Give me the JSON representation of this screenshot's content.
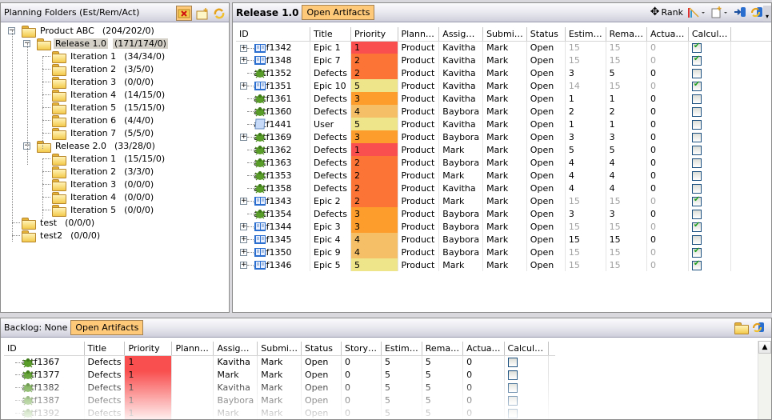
{
  "planning": {
    "title": "Planning Folders (Est/Rem/Act)",
    "toolbar": [
      {
        "name": "delete-folder-icon"
      },
      {
        "name": "new-folder-icon"
      },
      {
        "name": "refresh-icon"
      }
    ],
    "tree": [
      {
        "label": "Product ABC",
        "count": "(204/202/0)",
        "level": 0,
        "expand": "minus"
      },
      {
        "label": "Release 1.0",
        "count": "(171/174/0)",
        "level": 1,
        "expand": "minus",
        "selected": true
      },
      {
        "label": "Iteration 1",
        "count": "(34/34/0)",
        "level": 2
      },
      {
        "label": "Iteration 2",
        "count": "(3/5/0)",
        "level": 2
      },
      {
        "label": "Iteration 3",
        "count": "(0/0/0)",
        "level": 2
      },
      {
        "label": "Iteration 4",
        "count": "(14/15/0)",
        "level": 2
      },
      {
        "label": "Iteration 5",
        "count": "(15/15/0)",
        "level": 2
      },
      {
        "label": "Iteration 6",
        "count": "(4/4/0)",
        "level": 2
      },
      {
        "label": "Iteration 7",
        "count": "(5/5/0)",
        "level": 2
      },
      {
        "label": "Release 2.0",
        "count": "(33/28/0)",
        "level": 1,
        "expand": "minus"
      },
      {
        "label": "Iteration 1",
        "count": "(15/15/0)",
        "level": 2
      },
      {
        "label": "Iteration 2",
        "count": "(3/3/0)",
        "level": 2
      },
      {
        "label": "Iteration 3",
        "count": "(0/0/0)",
        "level": 2
      },
      {
        "label": "Iteration 4",
        "count": "(0/0/0)",
        "level": 2
      },
      {
        "label": "Iteration 5",
        "count": "(0/0/0)",
        "level": 2
      },
      {
        "label": "test",
        "count": "(0/0/0)",
        "level": 0
      },
      {
        "label": "test2",
        "count": "(0/0/0)",
        "level": 0
      }
    ]
  },
  "release": {
    "title": "Release 1.0",
    "filter_button": "Open Artifacts",
    "rank_label": "Rank",
    "columns": [
      "ID",
      "Title",
      "Priority",
      "Plann…",
      "Assig…",
      "Submi…",
      "Status",
      "Estim…",
      "Rema…",
      "Actua…",
      "Calcul…"
    ],
    "rows": [
      {
        "id": "artf1342",
        "type": "epic",
        "expand": true,
        "title": "Epic 1",
        "priority": 1,
        "planning": "Product",
        "assigned": "Kavitha",
        "submitted": "Mark",
        "status": "Open",
        "est": "15",
        "rem": "15",
        "act": "0",
        "calc": true
      },
      {
        "id": "artf1348",
        "type": "epic",
        "expand": true,
        "title": "Epic 7",
        "priority": 2,
        "planning": "Product",
        "assigned": "Kavitha",
        "submitted": "Mark",
        "status": "Open",
        "est": "15",
        "rem": "15",
        "act": "0",
        "calc": true
      },
      {
        "id": "artf1352",
        "type": "bug",
        "expand": false,
        "title": "Defects",
        "priority": 2,
        "planning": "Product",
        "assigned": "Kavitha",
        "submitted": "Mark",
        "status": "Open",
        "est": "3",
        "rem": "5",
        "act": "0",
        "calc": false
      },
      {
        "id": "artf1351",
        "type": "epic",
        "expand": true,
        "title": "Epic 10",
        "priority": 5,
        "planning": "Product",
        "assigned": "Kavitha",
        "submitted": "Mark",
        "status": "Open",
        "est": "14",
        "rem": "15",
        "act": "0",
        "calc": true
      },
      {
        "id": "artf1361",
        "type": "bug",
        "expand": false,
        "title": "Defects",
        "priority": 3,
        "planning": "Product",
        "assigned": "Kavitha",
        "submitted": "Mark",
        "status": "Open",
        "est": "1",
        "rem": "1",
        "act": "0",
        "calc": false
      },
      {
        "id": "artf1360",
        "type": "bug",
        "expand": false,
        "title": "Defects",
        "priority": 4,
        "planning": "Product",
        "assigned": "Baybora",
        "submitted": "Mark",
        "status": "Open",
        "est": "2",
        "rem": "2",
        "act": "0",
        "calc": false
      },
      {
        "id": "artf1441",
        "type": "user",
        "expand": false,
        "title": "User",
        "priority": 5,
        "planning": "Product",
        "assigned": "Kavitha",
        "submitted": "Mark",
        "status": "Open",
        "est": "1",
        "rem": "1",
        "act": "0",
        "calc": false
      },
      {
        "id": "artf1369",
        "type": "bug",
        "expand": true,
        "title": "Defects",
        "priority": 3,
        "planning": "Product",
        "assigned": "Baybora",
        "submitted": "Mark",
        "status": "Open",
        "est": "3",
        "rem": "3",
        "act": "0",
        "calc": false
      },
      {
        "id": "artf1362",
        "type": "bug",
        "expand": false,
        "title": "Defects",
        "priority": 1,
        "planning": "Product",
        "assigned": "Mark",
        "submitted": "Mark",
        "status": "Open",
        "est": "5",
        "rem": "5",
        "act": "0",
        "calc": false
      },
      {
        "id": "artf1363",
        "type": "bug",
        "expand": false,
        "title": "Defects",
        "priority": 2,
        "planning": "Product",
        "assigned": "Baybora",
        "submitted": "Mark",
        "status": "Open",
        "est": "4",
        "rem": "4",
        "act": "0",
        "calc": false
      },
      {
        "id": "artf1353",
        "type": "bug",
        "expand": false,
        "title": "Defects",
        "priority": 2,
        "planning": "Product",
        "assigned": "Mark",
        "submitted": "Mark",
        "status": "Open",
        "est": "4",
        "rem": "4",
        "act": "0",
        "calc": false
      },
      {
        "id": "artf1358",
        "type": "bug",
        "expand": false,
        "title": "Defects",
        "priority": 2,
        "planning": "Product",
        "assigned": "Kavitha",
        "submitted": "Mark",
        "status": "Open",
        "est": "4",
        "rem": "4",
        "act": "0",
        "calc": false
      },
      {
        "id": "artf1343",
        "type": "epic",
        "expand": true,
        "title": "Epic 2",
        "priority": 2,
        "planning": "Product",
        "assigned": "Mark",
        "submitted": "Mark",
        "status": "Open",
        "est": "15",
        "rem": "15",
        "act": "0",
        "calc": true
      },
      {
        "id": "artf1354",
        "type": "bug",
        "expand": false,
        "title": "Defects",
        "priority": 3,
        "planning": "Product",
        "assigned": "Baybora",
        "submitted": "Mark",
        "status": "Open",
        "est": "3",
        "rem": "3",
        "act": "0",
        "calc": false
      },
      {
        "id": "artf1344",
        "type": "epic",
        "expand": true,
        "title": "Epic 3",
        "priority": 3,
        "planning": "Product",
        "assigned": "Baybora",
        "submitted": "Mark",
        "status": "Open",
        "est": "15",
        "rem": "15",
        "act": "0",
        "calc": true
      },
      {
        "id": "artf1345",
        "type": "epic",
        "expand": true,
        "title": "Epic 4",
        "priority": 4,
        "planning": "Product",
        "assigned": "Baybora",
        "submitted": "Mark",
        "status": "Open",
        "est": "15",
        "rem": "15",
        "act": "0",
        "calc": false
      },
      {
        "id": "artf1350",
        "type": "epic",
        "expand": true,
        "title": "Epic 9",
        "priority": 4,
        "planning": "Product",
        "assigned": "Baybora",
        "submitted": "Mark",
        "status": "Open",
        "est": "15",
        "rem": "15",
        "act": "0",
        "calc": true
      },
      {
        "id": "artf1346",
        "type": "epic",
        "expand": true,
        "title": "Epic 5",
        "priority": 5,
        "planning": "Product",
        "assigned": "Mark",
        "submitted": "Mark",
        "status": "Open",
        "est": "15",
        "rem": "15",
        "act": "0",
        "calc": true
      }
    ]
  },
  "backlog": {
    "title": "Backlog: None",
    "filter_button": "Open Artifacts",
    "columns": [
      "ID",
      "Title",
      "Priority",
      "Plann…",
      "Assig…",
      "Submi…",
      "Status",
      "Story…",
      "Estim…",
      "Rema…",
      "Actua…",
      "Calcul…"
    ],
    "rows": [
      {
        "id": "artf1367",
        "title": "Defects",
        "priority": 1,
        "planning": "",
        "assigned": "Kavitha",
        "submitted": "Mark",
        "status": "Open",
        "story": "0",
        "est": "5",
        "rem": "5",
        "act": "0",
        "calc": false
      },
      {
        "id": "artf1377",
        "title": "Defects",
        "priority": 1,
        "planning": "",
        "assigned": "Mark",
        "submitted": "Mark",
        "status": "Open",
        "story": "0",
        "est": "5",
        "rem": "5",
        "act": "0",
        "calc": false
      },
      {
        "id": "artf1382",
        "title": "Defects",
        "priority": 1,
        "planning": "",
        "assigned": "Kavitha",
        "submitted": "Mark",
        "status": "Open",
        "story": "0",
        "est": "5",
        "rem": "5",
        "act": "0",
        "calc": false
      },
      {
        "id": "artf1387",
        "title": "Defects",
        "priority": 1,
        "planning": "",
        "assigned": "Baybora",
        "submitted": "Mark",
        "status": "Open",
        "story": "0",
        "est": "5",
        "rem": "5",
        "act": "0",
        "calc": false
      },
      {
        "id": "artf1392",
        "title": "Defects",
        "priority": 1,
        "planning": "",
        "assigned": "Mark",
        "submitted": "Mark",
        "status": "Open",
        "story": "0",
        "est": "5",
        "rem": "5",
        "act": "0",
        "calc": false
      }
    ]
  },
  "colors": {
    "priority_1": "#f94f4f",
    "priority_2": "#fd7437",
    "priority_3": "#fd9d2b",
    "priority_4": "#f5bf68",
    "priority_5": "#eee48a",
    "filter_button": "#ffc97a",
    "selected_node": "#d4d0c8"
  }
}
